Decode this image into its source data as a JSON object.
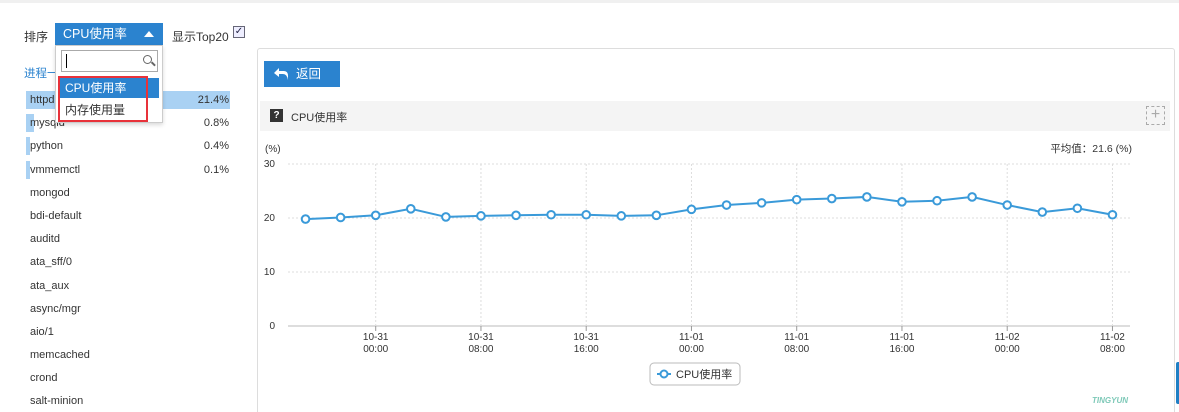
{
  "toolbar": {
    "sort_label": "排序",
    "sort_selected": "CPU使用率",
    "top20_label": "显示Top20",
    "top20_checked": "✓"
  },
  "dropdown": {
    "search_value": "",
    "options": [
      "CPU使用率",
      "内存使用量"
    ]
  },
  "process_list": {
    "header": "进程一",
    "items": [
      {
        "name": "httpd",
        "pct": "21.4%",
        "value": 21.4
      },
      {
        "name": "mysqld",
        "pct": "0.8%",
        "value": 0.8
      },
      {
        "name": "python",
        "pct": "0.4%",
        "value": 0.4
      },
      {
        "name": "vmmemctl",
        "pct": "0.1%",
        "value": 0.1
      },
      {
        "name": "mongod",
        "pct": "",
        "value": 0
      },
      {
        "name": "bdi-default",
        "pct": "",
        "value": 0
      },
      {
        "name": "auditd",
        "pct": "",
        "value": 0
      },
      {
        "name": "ata_sff/0",
        "pct": "",
        "value": 0
      },
      {
        "name": "ata_aux",
        "pct": "",
        "value": 0
      },
      {
        "name": "async/mgr",
        "pct": "",
        "value": 0
      },
      {
        "name": "aio/1",
        "pct": "",
        "value": 0
      },
      {
        "name": "memcached",
        "pct": "",
        "value": 0
      },
      {
        "name": "crond",
        "pct": "",
        "value": 0
      },
      {
        "name": "salt-minion",
        "pct": "",
        "value": 0
      }
    ]
  },
  "panel": {
    "back_label": "返回",
    "chart_title": "CPU使用率",
    "help_glyph": "?",
    "add_glyph": "+"
  },
  "watermark": "TINGYUN",
  "colors": {
    "accent": "#2b83cf",
    "series": "#3a9ad9",
    "highlight_box": "#e8323a",
    "bar_fill": "#a9d1f3"
  },
  "chart_data": {
    "type": "line",
    "title": "",
    "ylabel": "(%)",
    "ylim": [
      0,
      30
    ],
    "yticks": [
      0,
      10,
      20,
      30
    ],
    "x_ticks": [
      {
        "date": "10-31",
        "time": "00:00",
        "pos": 2.5
      },
      {
        "date": "10-31",
        "time": "08:00",
        "pos": 5.5
      },
      {
        "date": "10-31",
        "time": "16:00",
        "pos": 8.5
      },
      {
        "date": "11-01",
        "time": "00:00",
        "pos": 11.5
      },
      {
        "date": "11-01",
        "time": "08:00",
        "pos": 14.5
      },
      {
        "date": "11-01",
        "time": "16:00",
        "pos": 17.5
      },
      {
        "date": "11-02",
        "time": "00:00",
        "pos": 20.5
      },
      {
        "date": "11-02",
        "time": "08:00",
        "pos": 23.5
      }
    ],
    "avg_label": "平均值：21.6 (%)",
    "series": [
      {
        "name": "CPU使用率",
        "values": [
          19.8,
          20.1,
          20.5,
          21.7,
          20.2,
          20.4,
          20.5,
          20.6,
          20.6,
          20.4,
          20.5,
          21.6,
          22.4,
          22.8,
          23.4,
          23.6,
          23.9,
          23.0,
          23.2,
          23.9,
          22.4,
          21.1,
          21.8,
          20.6
        ]
      }
    ],
    "legend_position": "bottom-center",
    "grid": true
  }
}
